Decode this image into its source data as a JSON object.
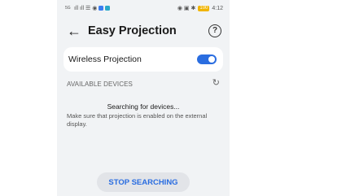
{
  "status_bar": {
    "sim_label_1": "5G",
    "sim_label_2": "5G",
    "signal_glyphs": "ıll ıll ☰ ◉",
    "right_glyphs": "◉ ▣ ✱",
    "battery": "100",
    "time": "4:12"
  },
  "header": {
    "back_icon": "←",
    "title": "Easy Projection",
    "help_icon": "?"
  },
  "wireless": {
    "label": "Wireless Projection",
    "enabled": true
  },
  "devices": {
    "section_title": "AVAILABLE DEVICES",
    "refresh_icon": "↻",
    "searching": "Searching for devices...",
    "hint": "Make sure that projection is enabled on the external display."
  },
  "footer": {
    "stop_label": "STOP SEARCHING"
  },
  "colors": {
    "accent": "#2a6de0",
    "background": "#f1f3f5",
    "battery": "#f0b400"
  }
}
